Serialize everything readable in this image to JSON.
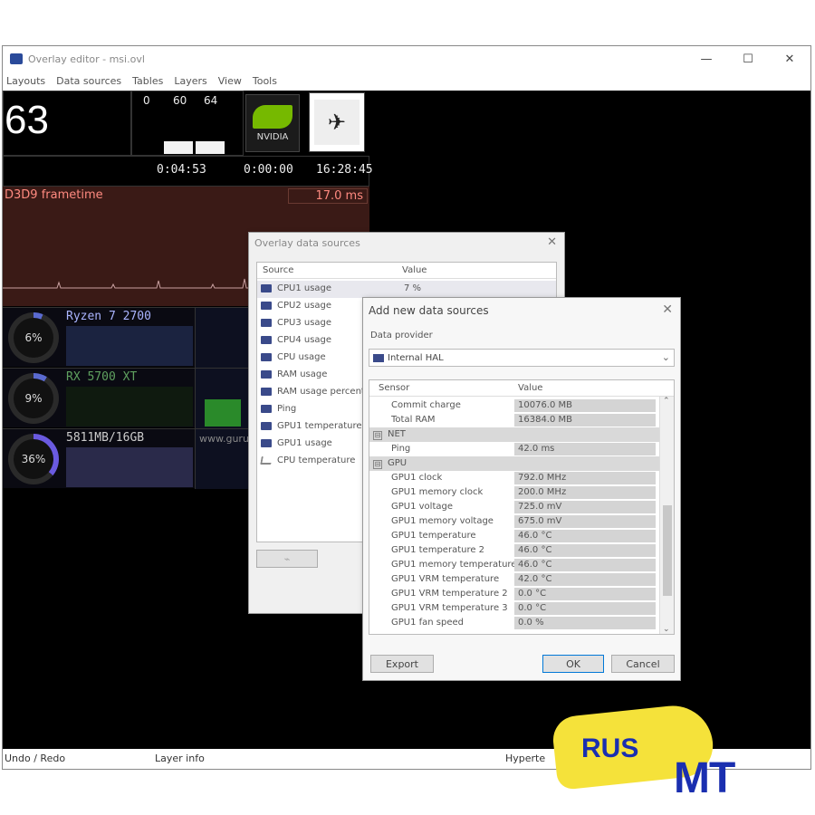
{
  "window": {
    "title": "Overlay editor - msi.ovl",
    "controls": [
      "—",
      "☐",
      "✕"
    ]
  },
  "menu": [
    "Layouts",
    "Data sources",
    "Tables",
    "Layers",
    "View",
    "Tools"
  ],
  "overlay": {
    "fps": "63",
    "mini_values": [
      "0",
      "60",
      "64"
    ],
    "timers": [
      "0:04:53",
      "0:00:00",
      "16:28:45"
    ],
    "nvidia_label": "NVIDIA",
    "frametime_label": "D3D9 frametime",
    "frametime_value": "17.0 ms",
    "rows": [
      {
        "name": "Ryzen 7 2700",
        "percent": "6%",
        "level": 0.06
      },
      {
        "name": "RX 5700 XT",
        "percent": "9%",
        "level": 0.09
      },
      {
        "name": "5811MB/16GB",
        "percent": "36%",
        "level": 0.36
      }
    ],
    "row3_extra": "www.guru"
  },
  "dialog_sources": {
    "title": "Overlay data sources",
    "col_source": "Source",
    "col_value": "Value",
    "items": [
      {
        "name": "CPU1 usage",
        "value": "7 %"
      },
      {
        "name": "CPU2 usage",
        "value": ""
      },
      {
        "name": "CPU3 usage",
        "value": ""
      },
      {
        "name": "CPU4 usage",
        "value": ""
      },
      {
        "name": "CPU usage",
        "value": ""
      },
      {
        "name": "RAM usage",
        "value": ""
      },
      {
        "name": "RAM usage percent",
        "value": ""
      },
      {
        "name": "Ping",
        "value": ""
      },
      {
        "name": "GPU1 temperature",
        "value": ""
      },
      {
        "name": "GPU1 usage",
        "value": ""
      },
      {
        "name": "CPU temperature",
        "value": ""
      }
    ]
  },
  "dialog_add": {
    "title": "Add new data sources",
    "provider_label": "Data provider",
    "provider_value": "Internal HAL",
    "col_sensor": "Sensor",
    "col_value": "Value",
    "rows": [
      {
        "name": "Commit charge",
        "value": "10076.0 MB",
        "group": false
      },
      {
        "name": "Total RAM",
        "value": "16384.0 MB",
        "group": false
      },
      {
        "name": "NET",
        "value": "",
        "group": true
      },
      {
        "name": "Ping",
        "value": "42.0 ms",
        "group": false
      },
      {
        "name": "GPU",
        "value": "",
        "group": true
      },
      {
        "name": "GPU1 clock",
        "value": "792.0 MHz",
        "group": false
      },
      {
        "name": "GPU1 memory clock",
        "value": "200.0 MHz",
        "group": false
      },
      {
        "name": "GPU1 voltage",
        "value": "725.0 mV",
        "group": false
      },
      {
        "name": "GPU1 memory voltage",
        "value": "675.0 mV",
        "group": false
      },
      {
        "name": "GPU1 temperature",
        "value": "46.0 °C",
        "group": false
      },
      {
        "name": "GPU1 temperature 2",
        "value": "46.0 °C",
        "group": false
      },
      {
        "name": "GPU1 memory temperature",
        "value": "46.0 °C",
        "group": false
      },
      {
        "name": "GPU1 VRM temperature",
        "value": "42.0 °C",
        "group": false
      },
      {
        "name": "GPU1 VRM temperature 2",
        "value": "0.0 °C",
        "group": false
      },
      {
        "name": "GPU1 VRM temperature 3",
        "value": "0.0 °C",
        "group": false
      },
      {
        "name": "GPU1 fan speed",
        "value": "0.0 %",
        "group": false
      }
    ],
    "export_label": "Export",
    "ok_label": "OK",
    "cancel_label": "Cancel"
  },
  "status": {
    "undo": "Undo / Redo",
    "layer": "Layer info",
    "hyper": "Hyperte"
  },
  "watermark": {
    "rus": "RUS",
    "mt": "MT"
  }
}
